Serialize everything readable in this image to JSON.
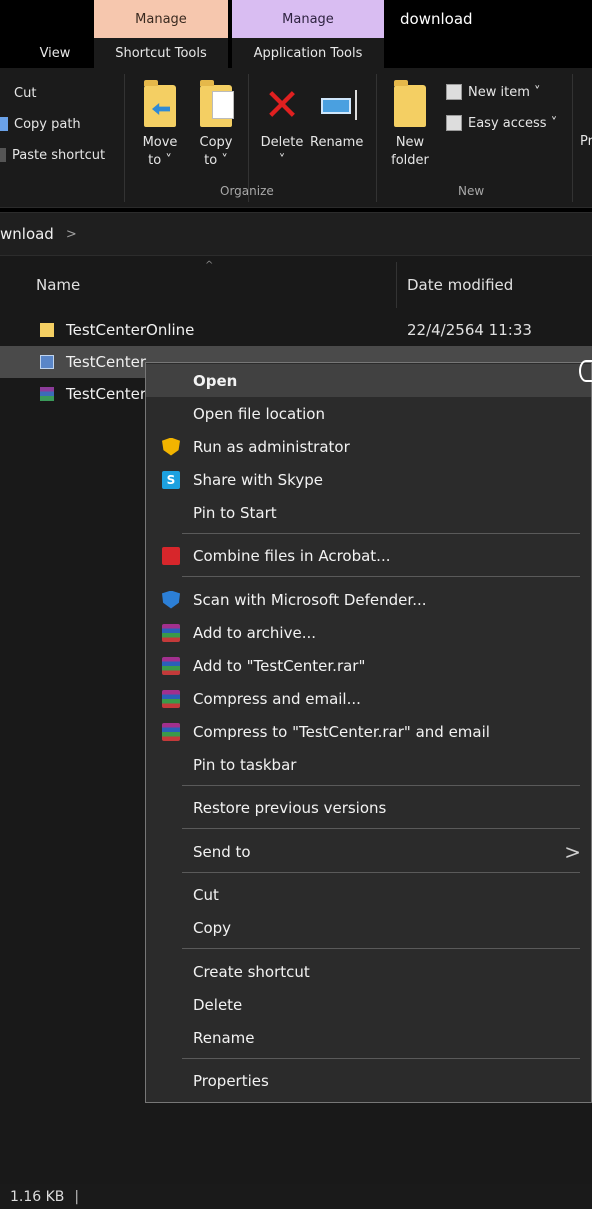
{
  "ribbon_tabs": {
    "context_tabs": [
      "Manage",
      "Manage"
    ],
    "window_title": "download",
    "tabs": [
      "View",
      "Shortcut Tools",
      "Application Tools"
    ]
  },
  "ribbon": {
    "clipboard": {
      "cut": "Cut",
      "copy_path": "Copy path",
      "paste_shortcut": "Paste shortcut"
    },
    "organize": {
      "move_line1": "Move",
      "move_line2": "to ˅",
      "copy_line1": "Copy",
      "copy_line2": "to ˅",
      "delete": "Delete",
      "delete_caret": "˅",
      "rename": "Rename",
      "label": "Organize"
    },
    "new": {
      "new_folder_line1": "New",
      "new_folder_line2": "folder",
      "new_item": "New item ˅",
      "easy_access": "Easy access ˅",
      "label": "New"
    },
    "cut_off_text": "Pr"
  },
  "address": {
    "path": "wnload",
    "separator": ">"
  },
  "columns": {
    "name": "Name",
    "date_modified": "Date modified"
  },
  "files": [
    {
      "name": "TestCenterOnline",
      "date": "22/4/2564 11:33",
      "icon": "folder-icon"
    },
    {
      "name": "TestCenter",
      "date": "",
      "icon": "shortcut-app-icon"
    },
    {
      "name": "TestCenter",
      "date": "",
      "icon": "rar-archive-icon"
    }
  ],
  "context_menu": {
    "items": [
      {
        "label": "Open",
        "icon": ""
      },
      {
        "label": "Open file location",
        "icon": ""
      },
      {
        "label": "Run as administrator",
        "icon": "uac-shield-icon"
      },
      {
        "label": "Share with Skype",
        "icon": "skype-icon"
      },
      {
        "label": "Pin to Start",
        "icon": ""
      },
      {
        "label": "Combine files in Acrobat...",
        "icon": "acrobat-icon"
      },
      {
        "label": "Scan with Microsoft Defender...",
        "icon": "defender-icon"
      },
      {
        "label": "Add to archive...",
        "icon": "winrar-icon"
      },
      {
        "label": "Add to \"TestCenter.rar\"",
        "icon": "winrar-icon"
      },
      {
        "label": "Compress and email...",
        "icon": "winrar-icon"
      },
      {
        "label": "Compress to \"TestCenter.rar\" and email",
        "icon": "winrar-icon"
      },
      {
        "label": "Pin to taskbar",
        "icon": ""
      },
      {
        "label": "Restore previous versions",
        "icon": ""
      },
      {
        "label": "Send to",
        "icon": ""
      },
      {
        "label": "Cut",
        "icon": ""
      },
      {
        "label": "Copy",
        "icon": ""
      },
      {
        "label": "Create shortcut",
        "icon": ""
      },
      {
        "label": "Delete",
        "icon": ""
      },
      {
        "label": "Rename",
        "icon": ""
      },
      {
        "label": "Properties",
        "icon": ""
      }
    ],
    "submenu_chevron": ">"
  },
  "status_bar": {
    "size": "1.16 KB",
    "divider": "|"
  }
}
